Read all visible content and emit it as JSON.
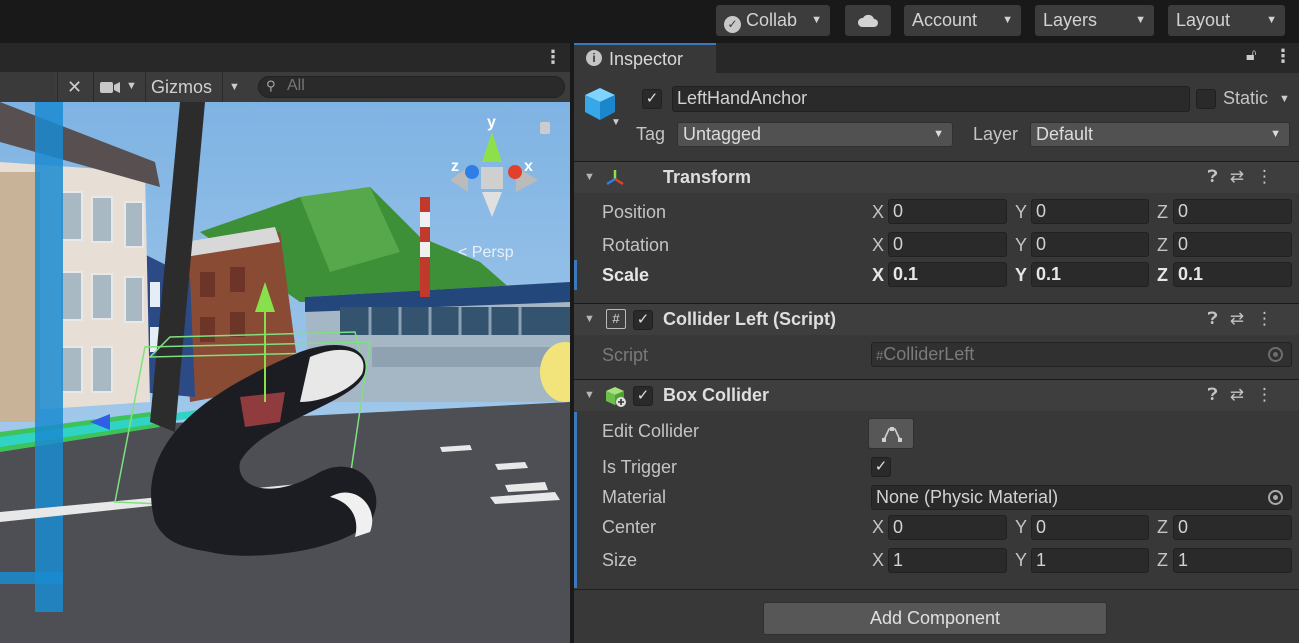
{
  "toolbar": {
    "collab": "Collab",
    "account": "Account",
    "layers": "Layers",
    "layout": "Layout"
  },
  "scene": {
    "gizmos": "Gizmos",
    "search_placeholder": "All",
    "persp": "Persp",
    "axis_x": "x",
    "axis_y": "y",
    "axis_z": "z"
  },
  "inspector": {
    "tab": "Inspector",
    "object_name": "LeftHandAnchor",
    "static_label": "Static",
    "tag_label": "Tag",
    "tag_value": "Untagged",
    "layer_label": "Layer",
    "layer_value": "Default",
    "transform": {
      "title": "Transform",
      "rows": [
        {
          "label": "Position",
          "x": "0",
          "y": "0",
          "z": "0"
        },
        {
          "label": "Rotation",
          "x": "0",
          "y": "0",
          "z": "0"
        },
        {
          "label": "Scale",
          "x": "0.1",
          "y": "0.1",
          "z": "0.1"
        }
      ]
    },
    "collider_left": {
      "title": "Collider Left (Script)",
      "script_label": "Script",
      "script_value": "ColliderLeft"
    },
    "box_collider": {
      "title": "Box Collider",
      "edit_collider": "Edit Collider",
      "is_trigger": "Is Trigger",
      "material_label": "Material",
      "material_value": "None (Physic Material)",
      "center_label": "Center",
      "center": {
        "x": "0",
        "y": "0",
        "z": "0"
      },
      "size_label": "Size",
      "size": {
        "x": "1",
        "y": "1",
        "z": "1"
      }
    },
    "add_component": "Add Component"
  },
  "axes": {
    "x": "X",
    "y": "Y",
    "z": "Z"
  },
  "colors": {
    "accent": "#3a79bb",
    "panel": "#383838",
    "toolbar": "#191919"
  }
}
